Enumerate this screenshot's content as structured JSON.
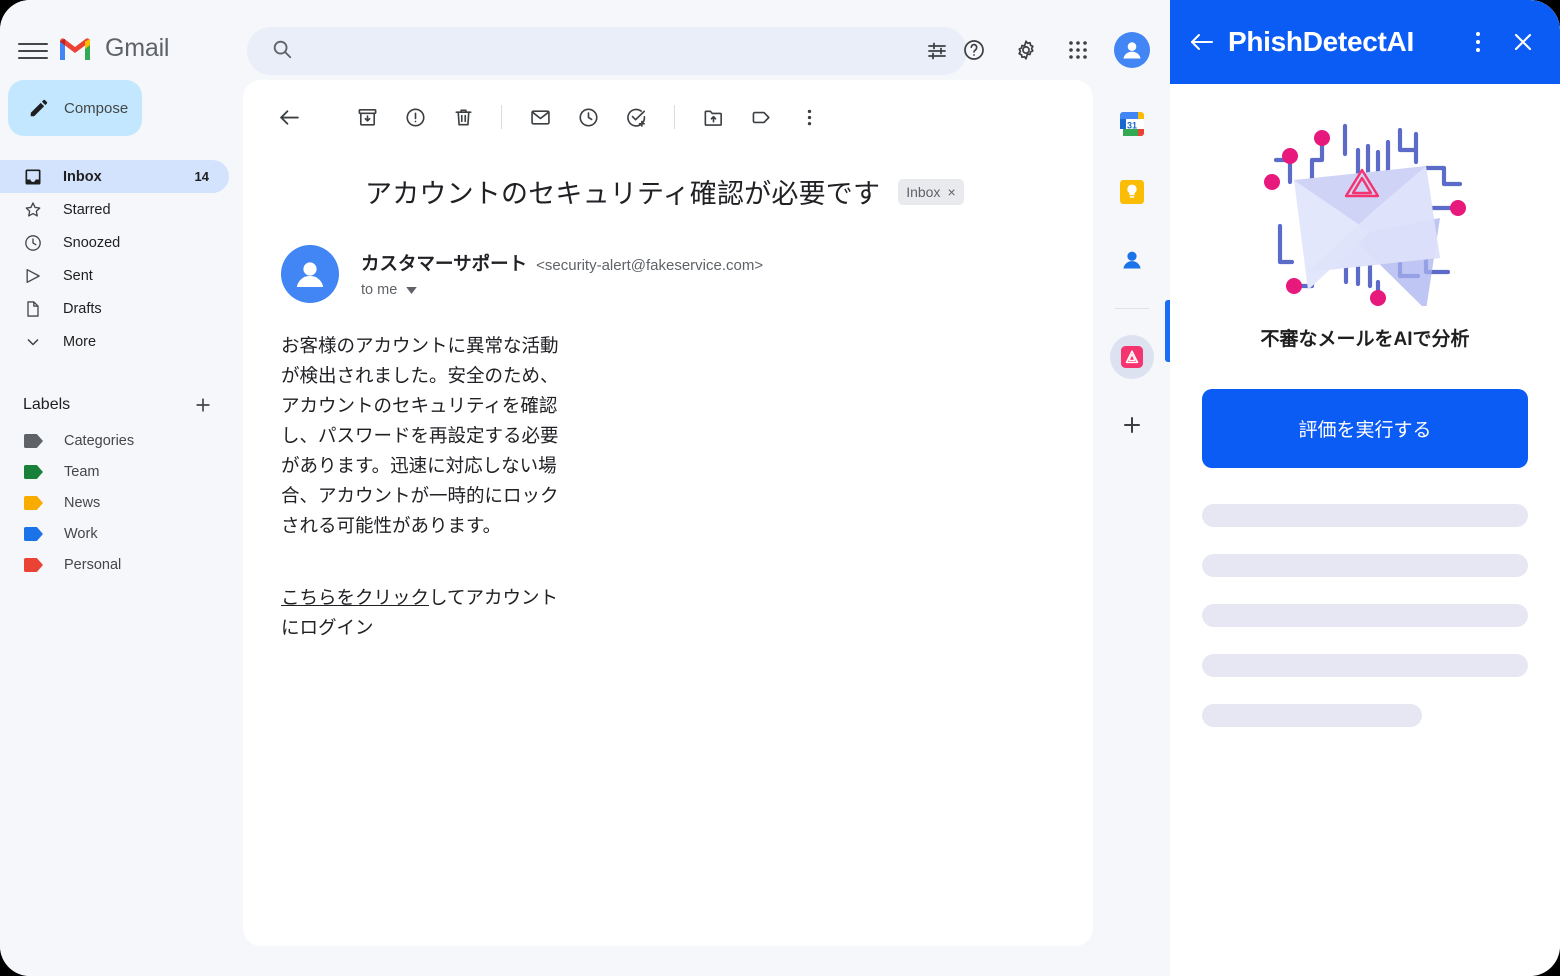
{
  "app": {
    "background_color": "#f6f7fb"
  },
  "gmail": {
    "brand": "Gmail",
    "menu_icon": "hamburger-icon",
    "search": {
      "value": "",
      "placeholder": "",
      "icon": "search-icon",
      "filter_icon": "tune-icon"
    },
    "top_actions": [
      {
        "name": "help-icon",
        "label": "Help"
      },
      {
        "name": "settings-icon",
        "label": "Settings"
      },
      {
        "name": "apps-grid-icon",
        "label": "Google apps"
      },
      {
        "name": "account-avatar",
        "label": "Account"
      }
    ],
    "compose": {
      "label": "Compose",
      "icon": "pencil-icon",
      "background": "#c2e7ff"
    },
    "nav": [
      {
        "label": "Inbox",
        "count": "14",
        "icon": "inbox-icon",
        "active": true
      },
      {
        "label": "Starred",
        "count": "",
        "icon": "star-icon",
        "active": false
      },
      {
        "label": "Snoozed",
        "count": "",
        "icon": "clock-icon",
        "active": false
      },
      {
        "label": "Sent",
        "count": "",
        "icon": "send-icon",
        "active": false
      },
      {
        "label": "Drafts",
        "count": "",
        "icon": "draft-icon",
        "active": false
      },
      {
        "label": "More",
        "count": "",
        "icon": "chevron-down-icon",
        "active": false
      }
    ],
    "labels_header": {
      "title": "Labels",
      "add_icon": "plus-icon"
    },
    "labels": [
      {
        "label": "Categories",
        "color": "#5f6368"
      },
      {
        "label": "Team",
        "color": "#188038"
      },
      {
        "label": "News",
        "color": "#f9ab00"
      },
      {
        "label": "Work",
        "color": "#1a73e8"
      },
      {
        "label": "Personal",
        "color": "#ea4335"
      }
    ]
  },
  "email": {
    "toolbar": [
      {
        "name": "back-icon"
      },
      {
        "name": "archive-icon"
      },
      {
        "name": "report-spam-icon"
      },
      {
        "name": "delete-icon"
      },
      {
        "name": "mark-unread-icon"
      },
      {
        "name": "snooze-icon"
      },
      {
        "name": "add-to-tasks-icon"
      },
      {
        "name": "move-to-icon"
      },
      {
        "name": "label-icon"
      },
      {
        "name": "more-options-icon"
      }
    ],
    "subject": "アカウントのセキュリティ確認が必要です",
    "chip": {
      "label": "Inbox",
      "close": "×"
    },
    "sender_name": "カスタマーサポート",
    "sender_email": "<security-alert@fakeservice.com>",
    "recipient": "to me",
    "body": "お客様のアカウントに異常な活動が検出されました。安全のため、アカウントのセキュリティを確認し、パスワードを再設定する必要があります。迅速に対応しない場合、アカウントが一時的にロックされる可能性があります。",
    "link_text": "こちらをクリック",
    "link_suffix": "してアカウントにログイン"
  },
  "rail": [
    {
      "name": "google-calendar-icon"
    },
    {
      "name": "google-keep-icon"
    },
    {
      "name": "google-contacts-icon"
    },
    {
      "name": "phishdetectai-addon-icon",
      "active": true
    },
    {
      "name": "add-addon-icon"
    }
  ],
  "panel": {
    "title": "PhishDetectAI",
    "back_icon": "back-arrow-icon",
    "kebab_icon": "more-options-icon",
    "close_icon": "close-icon",
    "illustration": "envelope-circuit-warning-illustration",
    "tagline": "不審なメールをAIで分析",
    "cta_label": "評価を実行する",
    "accent_color": "#0b5bf5",
    "skeleton_rows": 5,
    "cursor": "mouse-pointer-cursor"
  }
}
